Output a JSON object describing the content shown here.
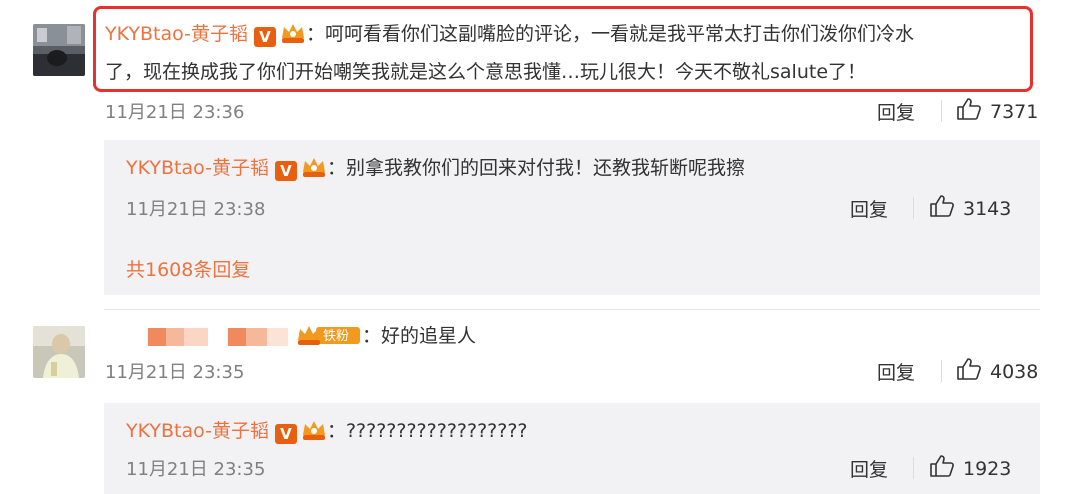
{
  "comment1": {
    "username": "YKYBtao-黄子韬",
    "badge": "V",
    "text_line1": "：呵呵看看你们这副嘴脸的评论，一看就是我平常太打击你们泼你们冷水",
    "text_line2": "了，现在换成我了你们开始嘲笑我就是这么个意思我懂…玩儿很大！今天不敬礼salute了！",
    "time": "11月21日 23:36",
    "reply_label": "回复",
    "likes": "7371"
  },
  "reply1": {
    "username": "YKYBtao-黄子韬",
    "badge": "V",
    "text": "：别拿我教你们的回来对付我！还教我斩断呢我擦",
    "time": "11月21日 23:38",
    "reply_label": "回复",
    "likes": "3143",
    "more_replies": "共1608条回复"
  },
  "comment2": {
    "fan_badge": "铁粉",
    "text": "：好的追星人",
    "time": "11月21日 23:35",
    "reply_label": "回复",
    "likes": "4038"
  },
  "reply2": {
    "username": "YKYBtao-黄子韬",
    "badge": "V",
    "text": "：??????????????????",
    "time": "11月21日 23:35",
    "reply_label": "回复",
    "likes": "1923"
  },
  "colors": {
    "username": "#eb7340",
    "highlight": "#e8302c",
    "reply_bg": "#f2f2f5"
  }
}
